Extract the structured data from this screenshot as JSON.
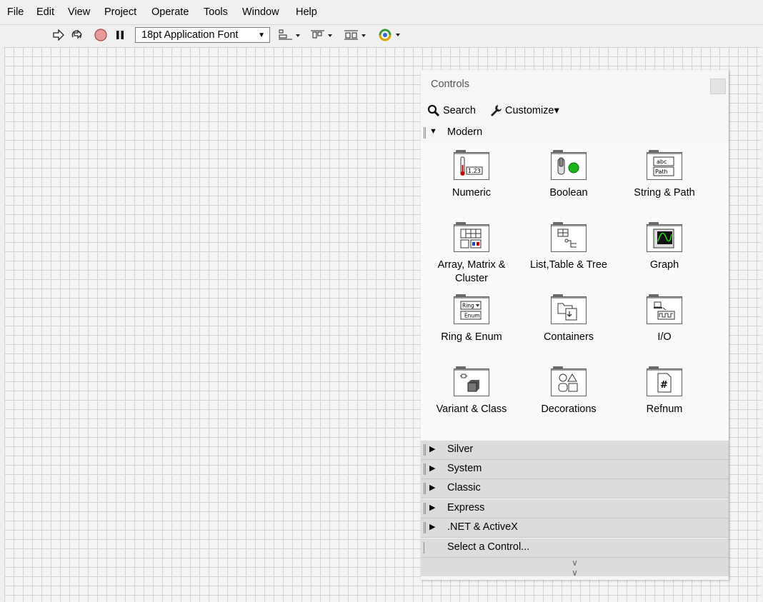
{
  "menu": [
    "File",
    "Edit",
    "View",
    "Project",
    "Operate",
    "Tools",
    "Window",
    "Help"
  ],
  "toolbar": {
    "font": "18pt Application Font"
  },
  "palette": {
    "title": "Controls",
    "search_label": "Search",
    "customize_label": "Customize▾",
    "modern_label": "Modern",
    "items": [
      {
        "label": "Numeric",
        "icon": "numeric-icon"
      },
      {
        "label": "Boolean",
        "icon": "boolean-icon"
      },
      {
        "label": "String & Path",
        "icon": "string-path-icon"
      },
      {
        "label": "Array, Matrix & Cluster",
        "icon": "array-matrix-cluster-icon"
      },
      {
        "label": "List,Table & Tree",
        "icon": "list-table-tree-icon"
      },
      {
        "label": "Graph",
        "icon": "graph-icon"
      },
      {
        "label": "Ring & Enum",
        "icon": "ring-enum-icon"
      },
      {
        "label": "Containers",
        "icon": "containers-icon"
      },
      {
        "label": "I/O",
        "icon": "io-icon"
      },
      {
        "label": "Variant & Class",
        "icon": "variant-class-icon"
      },
      {
        "label": "Decorations",
        "icon": "decorations-icon"
      },
      {
        "label": "Refnum",
        "icon": "refnum-icon"
      }
    ],
    "categories": [
      "Silver",
      "System",
      "Classic",
      "Express",
      ".NET & ActiveX"
    ],
    "select_control_label": "Select a Control..."
  }
}
